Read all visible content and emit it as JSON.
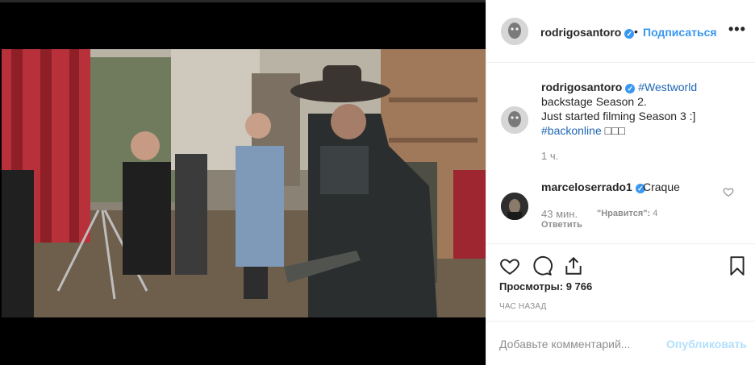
{
  "header": {
    "username": "rodrigosantoro",
    "separator": "•",
    "follow_label": "Подписаться",
    "more_label": "•••"
  },
  "caption": {
    "username": "rodrigosantoro",
    "tag1": "#Westworld",
    "line1_rest": "backstage Season 2.",
    "line2": "Just started filming Season 3 :]",
    "tag2": "#backonline",
    "trailing": "□□□",
    "time": "1 ч."
  },
  "comment": {
    "username": "marceloserrado1",
    "text": "Craque",
    "time": "43 мин.",
    "likes_label": "\"Нравится\":",
    "likes_count": "4",
    "reply_label": "Ответить"
  },
  "stats": {
    "views": "Просмотры: 9 766",
    "ago": "ЧАС НАЗАД"
  },
  "add_comment": {
    "placeholder": "Добавьте комментарий...",
    "publish_label": "Опубликовать"
  },
  "colors": {
    "accent": "#3897f0",
    "hashtag": "#1e65b5",
    "muted": "#8e8e8e",
    "publish_disabled": "#b2dffc"
  },
  "icons": {
    "like": "heart-icon",
    "comment": "comment-icon",
    "share": "share-icon",
    "save": "bookmark-icon",
    "verified": "verified-badge-icon",
    "more": "more-options-icon"
  }
}
